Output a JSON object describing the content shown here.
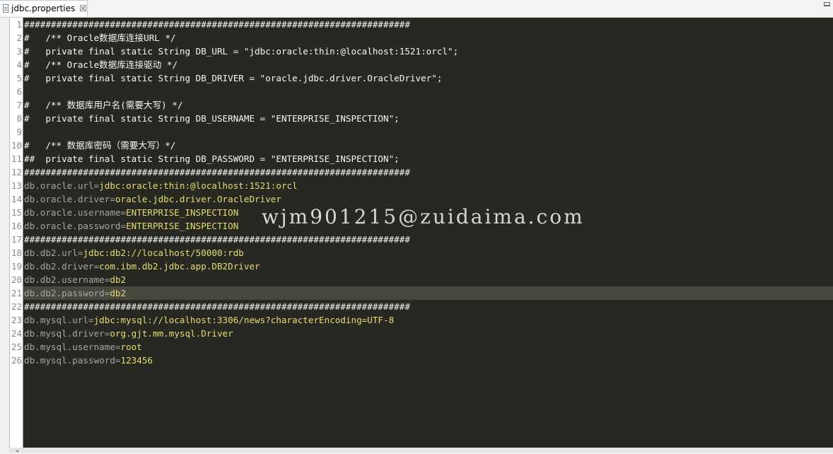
{
  "tab": {
    "title": "jdbc.properties",
    "close": "☒"
  },
  "watermark": "wjm901215@zuidaima.com",
  "current_line": 21,
  "lines": [
    {
      "n": "1",
      "text": "########################################################################"
    },
    {
      "n": "2",
      "text": "#   /** Oracle数据库连接URL */"
    },
    {
      "n": "3",
      "text": "#   private final static String DB_URL = \"jdbc:oracle:thin:@localhost:1521:orcl\";"
    },
    {
      "n": "4",
      "text": "#   /** Oracle数据库连接驱动 */"
    },
    {
      "n": "5",
      "text": "#   private final static String DB_DRIVER = \"oracle.jdbc.driver.OracleDriver\";"
    },
    {
      "n": "6",
      "text": ""
    },
    {
      "n": "7",
      "text": "#   /** 数据库用户名(需要大写) */"
    },
    {
      "n": "8",
      "text": "#   private final static String DB_USERNAME = \"ENTERPRISE_INSPECTION\";"
    },
    {
      "n": "9",
      "text": ""
    },
    {
      "n": "10",
      "text": "#   /** 数据库密码（需要大写）*/"
    },
    {
      "n": "11",
      "text": "##  private final static String DB_PASSWORD = \"ENTERPRISE_INSPECTION\";"
    },
    {
      "n": "12",
      "text": "########################################################################"
    },
    {
      "n": "13",
      "key": "db.oracle.url=",
      "value": "jdbc:oracle:thin:@localhost:1521:orcl"
    },
    {
      "n": "14",
      "key": "db.oracle.driver=",
      "value": "oracle.jdbc.driver.OracleDriver"
    },
    {
      "n": "15",
      "key": "db.oracle.username=",
      "value": "ENTERPRISE_INSPECTION"
    },
    {
      "n": "16",
      "key": "db.oracle.password=",
      "value": "ENTERPRISE_INSPECTION"
    },
    {
      "n": "17",
      "text": "########################################################################"
    },
    {
      "n": "18",
      "key": "db.db2.url=",
      "value": "jdbc:db2://localhost/50000:rdb"
    },
    {
      "n": "19",
      "key": "db.db2.driver=",
      "value": "com.ibm.db2.jdbc.app.DB2Driver"
    },
    {
      "n": "20",
      "key": "db.db2.username=",
      "value": "db2"
    },
    {
      "n": "21",
      "key": "db.db2.password=",
      "value": "db2"
    },
    {
      "n": "22",
      "text": "########################################################################"
    },
    {
      "n": "23",
      "key": "db.mysql.url=",
      "value": "jdbc:mysql://localhost:3306/news?characterEncoding=UTF-8"
    },
    {
      "n": "24",
      "key": "db.mysql.driver=",
      "value": "org.gjt.mm.mysql.Driver"
    },
    {
      "n": "25",
      "key": "db.mysql.username=",
      "value": "root"
    },
    {
      "n": "26",
      "key": "db.mysql.password=",
      "value": "123456"
    }
  ]
}
